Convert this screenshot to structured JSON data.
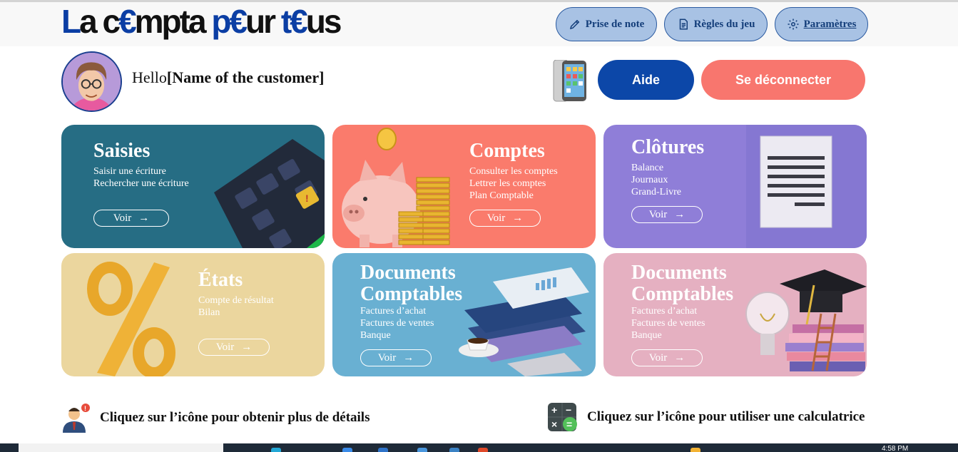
{
  "logo": {
    "text_parts": [
      {
        "t": "La ",
        "c": "#0b3ea4"
      },
      {
        "t": "c€mpta ",
        "c": "#111111"
      },
      {
        "t": "p€ur ",
        "c": "#0b3ea4"
      },
      {
        "t": "t€us",
        "c": "#111111"
      }
    ]
  },
  "logo_text": {
    "p1": "L",
    "p2": "a c",
    "p3": "€",
    "p4": "mpta ",
    "p5": "p",
    "p6": "€",
    "p7": "ur ",
    "p8": "t",
    "p9": "€",
    "p10": "us"
  },
  "nav": {
    "note_label": "Prise de note",
    "rules_label": "Règles du jeu",
    "settings_label": "Paramètres"
  },
  "greeting": {
    "hello": "Hello",
    "name": "[Name of the customer]"
  },
  "buttons": {
    "help": "Aide",
    "logout": "Se déconnecter"
  },
  "cards": [
    {
      "title": "Saisies",
      "lines": [
        "Saisir une écriture",
        "Rechercher une écriture"
      ],
      "voir": "Voir",
      "color": "#266d84"
    },
    {
      "title": "Comptes",
      "lines": [
        "Consulter les comptes",
        "Lettrer les comptes",
        "Plan Comptable"
      ],
      "voir": "Voir",
      "color": "#fa7b6c"
    },
    {
      "title": "Clôtures",
      "lines": [
        "Balance",
        "Journaux",
        "Grand-Livre"
      ],
      "voir": "Voir",
      "color": "#8f7ed8"
    },
    {
      "title": "États",
      "lines": [
        "Compte de résultat",
        "Bilan"
      ],
      "voir": "Voir",
      "color": "#ebd69e"
    },
    {
      "title_line1": "Documents",
      "title_line2": "Comptables",
      "lines": [
        "Factures d’achat",
        "Factures de ventes",
        "Banque"
      ],
      "voir": "Voir",
      "color": "#69b0d2"
    },
    {
      "title_line1": "Documents",
      "title_line2": "Comptables",
      "lines": [
        "Factures d’achat",
        "Factures de ventes",
        "Banque"
      ],
      "voir": "Voir",
      "color": "#e5b0c1"
    }
  ],
  "tips": {
    "details": "Cliquez sur l’icône pour obtenir plus de détails",
    "calculator": "Cliquez sur l’icône pour utiliser une calculatrice"
  },
  "taskbar": {
    "clock": "4:58 PM"
  },
  "icons": [
    "pencil-icon",
    "document-icon",
    "gear-icon",
    "phone-icon",
    "arrow-right-icon",
    "person-info-icon",
    "calculator-icon"
  ]
}
